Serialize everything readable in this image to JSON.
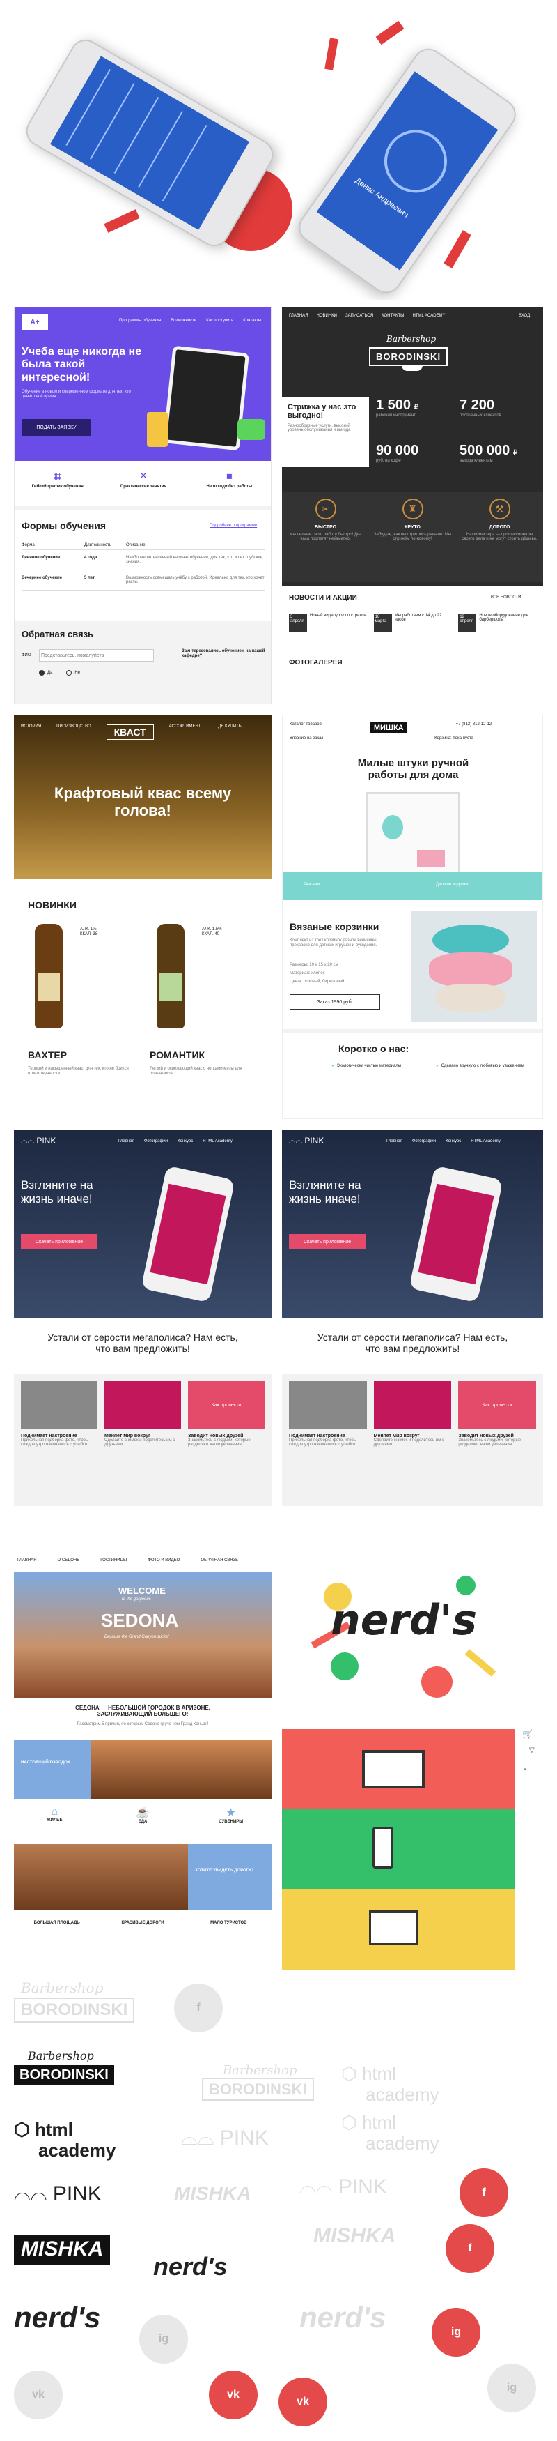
{
  "colors": {
    "accent_red": "#e23b3b",
    "purple": "#6a4de6",
    "pink_red": "#e44a4a",
    "nerds_red": "#f25d57",
    "nerds_green": "#34c06b",
    "nerds_yellow": "#f5d04d",
    "sedona_blue": "#7eaadf",
    "kvas_brown": "#6b4a18",
    "pink_dark": "#233047"
  },
  "hero": {
    "phone_left_caption": "",
    "phone_right_caption": "Денис Андреевич"
  },
  "academy": {
    "nav": [
      "Программы обучения",
      "Возможности",
      "Как поступить",
      "Контакты"
    ],
    "headline": "Учеба еще никогда не была такой интересной!",
    "subtext": "Обучение в новом и современном формате для тех, кто ценит своё время",
    "cta": "ПОДАТЬ ЗАЯВКУ",
    "features": [
      "Гибкий график обучения",
      "Практические занятия",
      "Не отходи без работы"
    ],
    "forms_title": "Формы обучения",
    "forms_link": "Подробнее о программе",
    "table_headers": [
      "Форма",
      "Длительность",
      "Описание"
    ],
    "table_rows": [
      [
        "Дневное обучение",
        "4 года",
        "Наиболее интенсивный вариант обучения, для тех, кто ищет глубокие знания."
      ],
      [
        "Вечернее обучение",
        "5 лет",
        "Возможность совмещать учёбу с работой. Идеально для тех, кто хочет расти."
      ]
    ],
    "feedback_title": "Обратная связь",
    "feedback_label": "ФИО",
    "feedback_placeholder": "Представьтесь, пожалуйста",
    "feedback_question": "Заинтересовались обучением на нашей кафедре?",
    "radio_yes": "Да",
    "radio_no": "Нет"
  },
  "borodinski": {
    "nav": [
      "ГЛАВНАЯ",
      "НОВИНКИ",
      "ЗАПИСАТЬСЯ",
      "КОНТАКТЫ",
      "HTML ACADEMY",
      "ВХОД"
    ],
    "brand_script": "Barbershop",
    "brand": "BORODINSKI",
    "promo_title": "Стрижка у нас это выгодно!",
    "promo_text": "Разнообразные услуги, высокий уровень обслуживания и выгода",
    "stats": [
      {
        "value": "1 500",
        "unit": "₽",
        "label": "рабочий инструмент"
      },
      {
        "value": "7 200",
        "unit": "",
        "label": "постоянных клиентов"
      },
      {
        "value": "90 000",
        "unit": "",
        "label": "руб. на кофе"
      },
      {
        "value": "500 000",
        "unit": "₽",
        "label": "выгода клиентам"
      }
    ],
    "features": [
      {
        "title": "БЫСТРО",
        "text": "Мы делаем свою работу быстро! Два часа пролетят незаметно."
      },
      {
        "title": "КРУТО",
        "text": "Забудьте, как вы стриглись раньше. Мы стрижём по-новому!"
      },
      {
        "title": "ДОРОГО",
        "text": "Наши мастера — профессионалы своего дела и не могут стоить дёшево."
      }
    ],
    "news_title": "НОВОСТИ И АКЦИИ",
    "news_all": "ВСЕ НОВОСТИ",
    "news": [
      {
        "date": "3 апреля",
        "text": "Новый видеоурок по стрижке"
      },
      {
        "date": "18 марта",
        "text": "Мы работаем с 14 до 22 часов"
      },
      {
        "date": "12 апреля",
        "text": "Новое оборудование для барбершопа"
      }
    ],
    "gallery_title": "ФОТОГАЛЕРЕЯ"
  },
  "kvas": {
    "nav": [
      "ИСТОРИЯ",
      "ПРОИЗВОДСТВО",
      "КВАСТ",
      "АССОРТИМЕНТ",
      "ГДЕ КУПИТЬ"
    ],
    "logo": "КВАСТ",
    "headline": "Крафтовый квас всему голова!",
    "new_title": "НОВИНКИ",
    "products": [
      {
        "name": "ВАХТЕР",
        "label_text": "Вахтер",
        "alc": "АЛК.",
        "alc_val": "1%",
        "kkal": "ККАЛ.",
        "kkal_val": "38",
        "desc": "Терпкий и насыщенный квас, для тех, кто не боится ответственности."
      },
      {
        "name": "РОМАНТИК",
        "label_text": "Романтик",
        "alc": "АЛК.",
        "alc_val": "1.5%",
        "kkal": "ККАЛ.",
        "kkal_val": "40",
        "desc": "Легкий и освежающий квас с нотками мяты для романтиков."
      }
    ]
  },
  "mishka": {
    "nav": [
      "Каталог товаров",
      "Вязание на заказ",
      "Корзина: пока пуста"
    ],
    "phone": "+7 (812) 812-12-12",
    "logo": "МИШКА",
    "headline": "Милые штуки ручной работы для дома",
    "tabs": [
      "Рюкзаки",
      "Детские игрушки"
    ],
    "product_title": "Вязаные корзинки",
    "product_text": "Комплект из трёх корзинок разной величины, прекрасно для детских игрушек и рукоделия.",
    "product_sizes": [
      "Размеры: 10 x 15 x 20 см",
      "Материал: хлопок",
      "Цвета: розовый, бирюзовый"
    ],
    "price": "Заказ 1990 руб.",
    "about_title": "Коротко о нас:",
    "about_items": [
      "Экологически чистые материалы",
      "Сделано вручную с любовью и уважением"
    ]
  },
  "pink_left": {
    "logo": "PINK",
    "nav": [
      "Главная",
      "Фотографии",
      "Конкурс",
      "HTML Academy"
    ],
    "headline": "Взгляните на жизнь иначе!",
    "download_text": "Скачать приложение",
    "tagline": "Устали от серости мегаполиса? Нам есть, что вам предложить!",
    "features": [
      {
        "title": "Поднимает настроение",
        "text": "Прикольная подборка фото, чтобы каждое утро начиналось с улыбки."
      },
      {
        "title": "Меняет мир вокруг",
        "text": "Сделайте снимок и поделитесь им с друзьями."
      },
      {
        "title": "Заводит новых друзей",
        "text": "Знакомьтесь с людьми, которые разделяют ваши увлечения."
      }
    ],
    "phone_screen_text": "Как провести"
  },
  "pink_right": {
    "logo": "PINK",
    "nav": [
      "Главная",
      "Фотографии",
      "Конкурс",
      "HTML Academy"
    ],
    "headline": "Взгляните на жизнь иначе!",
    "download_text": "Скачать приложение",
    "tagline": "Устали от серости мегаполиса? Нам есть, что вам предложить!",
    "features": [
      {
        "title": "Поднимает настроение",
        "text": "Прикольная подборка фото, чтобы каждое утро начиналось с улыбки."
      },
      {
        "title": "Меняет мир вокруг",
        "text": "Сделайте снимок и поделитесь им с друзьями."
      },
      {
        "title": "Заводит новых друзей",
        "text": "Знакомьтесь с людьми, которые разделяют ваши увлечения."
      }
    ],
    "phone_screen_text": "Как провести"
  },
  "sedona": {
    "nav": [
      "ГЛАВНАЯ",
      "О СЕДОНЕ",
      "ГОСТИНИЦЫ",
      "ФОТО И ВИДЕО",
      "ОБРАТНАЯ СВЯЗЬ"
    ],
    "welcome": "WELCOME",
    "sub_welcome": "to the gorgeous",
    "title": "SEDONA",
    "script": "Because the Grand Canyon sucks!",
    "lead": "СЕДОНА — НЕБОЛЬШОЙ ГОРОДОК В АРИЗОНЕ, ЗАСЛУЖИВАЮЩИЙ БОЛЬШЕГО!",
    "lead_sub": "Рассмотрим 5 причин, по которым Седона круче чем Гранд Каньон!",
    "block1": "НАСТОЯЩИЙ ГОРОДОК",
    "icons": [
      "ЖИЛЬЕ",
      "ЕДА",
      "СУВЕНИРЫ"
    ],
    "block2": "ХОТИТЕ УВИДЕТЬ ДОРОГУ?",
    "bottom": [
      "БОЛЬШАЯ ПЛОЩАДЬ",
      "КРАСИВЫЕ ДОРОГИ",
      "МАЛО ТУРИСТОВ"
    ]
  },
  "nerds": {
    "logo": "nerd's",
    "cart_icon": "cart-icon"
  },
  "logos": {
    "borodinski_script": "Barbershop",
    "borodinski": "BORODINSKI",
    "htmlacademy_1": "html",
    "htmlacademy_2": "academy",
    "pink": "PINK",
    "mishka": "MISHKA",
    "nerds": "nerd's"
  },
  "social": {
    "facebook": "f",
    "vk": "vk",
    "instagram": "ig"
  }
}
